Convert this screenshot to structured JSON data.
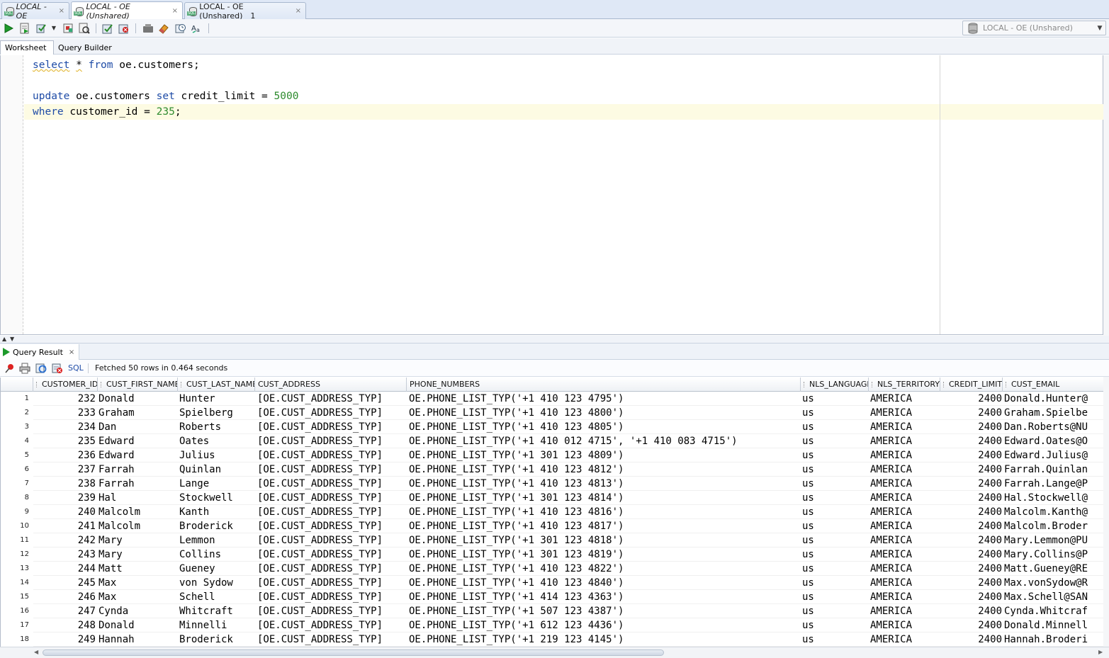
{
  "doc_tabs": [
    {
      "label": "LOCAL - OE",
      "close": "×"
    },
    {
      "label": "LOCAL - OE (Unshared)",
      "close": "×"
    },
    {
      "label": "LOCAL - OE (Unshared)__1",
      "close": "×"
    }
  ],
  "connection": {
    "label": "LOCAL - OE (Unshared)",
    "icon": "database-icon"
  },
  "sub_tabs": {
    "worksheet": "Worksheet",
    "query_builder": "Query Builder"
  },
  "editor": {
    "line1": {
      "kw1": "select",
      "star": "*",
      "kw2": "from",
      "rest": " oe.customers;"
    },
    "line3": {
      "kw1": "update",
      "mid": " oe.customers ",
      "kw2": "set",
      "mid2": " credit_limit = ",
      "num": "5000"
    },
    "line4": {
      "kw1": "where",
      "mid": " customer_id = ",
      "num": "235",
      "end": ";"
    }
  },
  "result": {
    "tab_label": "Query Result",
    "tab_close": "×",
    "sql_link": "SQL",
    "fetch_status": "Fetched 50 rows in 0.464 seconds"
  },
  "grid": {
    "columns": [
      "CUSTOMER_ID",
      "CUST_FIRST_NAME",
      "CUST_LAST_NAME",
      "CUST_ADDRESS",
      "PHONE_NUMBERS",
      "NLS_LANGUAGE",
      "NLS_TERRITORY",
      "CREDIT_LIMIT",
      "CUST_EMAIL"
    ],
    "rows": [
      [
        "1",
        "232",
        "Donald",
        "Hunter",
        "[OE.CUST_ADDRESS_TYP]",
        "OE.PHONE_LIST_TYP('+1 410 123 4795')",
        "us",
        "AMERICA",
        "2400",
        "Donald.Hunter@"
      ],
      [
        "2",
        "233",
        "Graham",
        "Spielberg",
        "[OE.CUST_ADDRESS_TYP]",
        "OE.PHONE_LIST_TYP('+1 410 123 4800')",
        "us",
        "AMERICA",
        "2400",
        "Graham.Spielbe"
      ],
      [
        "3",
        "234",
        "Dan",
        "Roberts",
        "[OE.CUST_ADDRESS_TYP]",
        "OE.PHONE_LIST_TYP('+1 410 123 4805')",
        "us",
        "AMERICA",
        "2400",
        "Dan.Roberts@NU"
      ],
      [
        "4",
        "235",
        "Edward",
        "Oates",
        "[OE.CUST_ADDRESS_TYP]",
        "OE.PHONE_LIST_TYP('+1 410 012 4715', '+1 410 083 4715')",
        "us",
        "AMERICA",
        "2400",
        "Edward.Oates@O"
      ],
      [
        "5",
        "236",
        "Edward",
        "Julius",
        "[OE.CUST_ADDRESS_TYP]",
        "OE.PHONE_LIST_TYP('+1 301 123 4809')",
        "us",
        "AMERICA",
        "2400",
        "Edward.Julius@"
      ],
      [
        "6",
        "237",
        "Farrah",
        "Quinlan",
        "[OE.CUST_ADDRESS_TYP]",
        "OE.PHONE_LIST_TYP('+1 410 123 4812')",
        "us",
        "AMERICA",
        "2400",
        "Farrah.Quinlan"
      ],
      [
        "7",
        "238",
        "Farrah",
        "Lange",
        "[OE.CUST_ADDRESS_TYP]",
        "OE.PHONE_LIST_TYP('+1 410 123 4813')",
        "us",
        "AMERICA",
        "2400",
        "Farrah.Lange@P"
      ],
      [
        "8",
        "239",
        "Hal",
        "Stockwell",
        "[OE.CUST_ADDRESS_TYP]",
        "OE.PHONE_LIST_TYP('+1 301 123 4814')",
        "us",
        "AMERICA",
        "2400",
        "Hal.Stockwell@"
      ],
      [
        "9",
        "240",
        "Malcolm",
        "Kanth",
        "[OE.CUST_ADDRESS_TYP]",
        "OE.PHONE_LIST_TYP('+1 410 123 4816')",
        "us",
        "AMERICA",
        "2400",
        "Malcolm.Kanth@"
      ],
      [
        "10",
        "241",
        "Malcolm",
        "Broderick",
        "[OE.CUST_ADDRESS_TYP]",
        "OE.PHONE_LIST_TYP('+1 410 123 4817')",
        "us",
        "AMERICA",
        "2400",
        "Malcolm.Broder"
      ],
      [
        "11",
        "242",
        "Mary",
        "Lemmon",
        "[OE.CUST_ADDRESS_TYP]",
        "OE.PHONE_LIST_TYP('+1 301 123 4818')",
        "us",
        "AMERICA",
        "2400",
        "Mary.Lemmon@PU"
      ],
      [
        "12",
        "243",
        "Mary",
        "Collins",
        "[OE.CUST_ADDRESS_TYP]",
        "OE.PHONE_LIST_TYP('+1 301 123 4819')",
        "us",
        "AMERICA",
        "2400",
        "Mary.Collins@P"
      ],
      [
        "13",
        "244",
        "Matt",
        "Gueney",
        "[OE.CUST_ADDRESS_TYP]",
        "OE.PHONE_LIST_TYP('+1 410 123 4822')",
        "us",
        "AMERICA",
        "2400",
        "Matt.Gueney@RE"
      ],
      [
        "14",
        "245",
        "Max",
        "von Sydow",
        "[OE.CUST_ADDRESS_TYP]",
        "OE.PHONE_LIST_TYP('+1 410 123 4840')",
        "us",
        "AMERICA",
        "2400",
        "Max.vonSydow@R"
      ],
      [
        "15",
        "246",
        "Max",
        "Schell",
        "[OE.CUST_ADDRESS_TYP]",
        "OE.PHONE_LIST_TYP('+1 414 123 4363')",
        "us",
        "AMERICA",
        "2400",
        "Max.Schell@SAN"
      ],
      [
        "16",
        "247",
        "Cynda",
        "Whitcraft",
        "[OE.CUST_ADDRESS_TYP]",
        "OE.PHONE_LIST_TYP('+1 507 123 4387')",
        "us",
        "AMERICA",
        "2400",
        "Cynda.Whitcraf"
      ],
      [
        "17",
        "248",
        "Donald",
        "Minnelli",
        "[OE.CUST_ADDRESS_TYP]",
        "OE.PHONE_LIST_TYP('+1 612 123 4436')",
        "us",
        "AMERICA",
        "2400",
        "Donald.Minnell"
      ],
      [
        "18",
        "249",
        "Hannah",
        "Broderick",
        "[OE.CUST_ADDRESS_TYP]",
        "OE.PHONE_LIST_TYP('+1 219 123 4145')",
        "us",
        "AMERICA",
        "2400",
        "Hannah.Broderi"
      ]
    ]
  },
  "colors": {
    "keyword": "#1e4ba6",
    "number": "#2e8b2e",
    "current_line": "#fdfbe3",
    "run_green": "#1d9a2a"
  }
}
